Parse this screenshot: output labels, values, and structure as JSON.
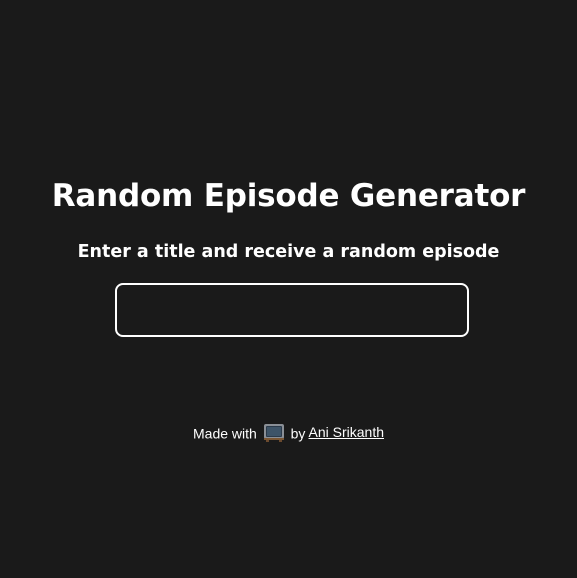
{
  "app": {
    "title": "Random Episode Generator",
    "subtitle": "Enter a title and receive a random episode"
  },
  "search": {
    "value": "",
    "placeholder": ""
  },
  "footer": {
    "prefix": "Made with",
    "icon": "television-icon",
    "by": "by",
    "author_link": "Ani Srikanth"
  },
  "colors": {
    "background": "#1a1a1a",
    "text": "#ffffff",
    "input_border": "#ffffff"
  }
}
